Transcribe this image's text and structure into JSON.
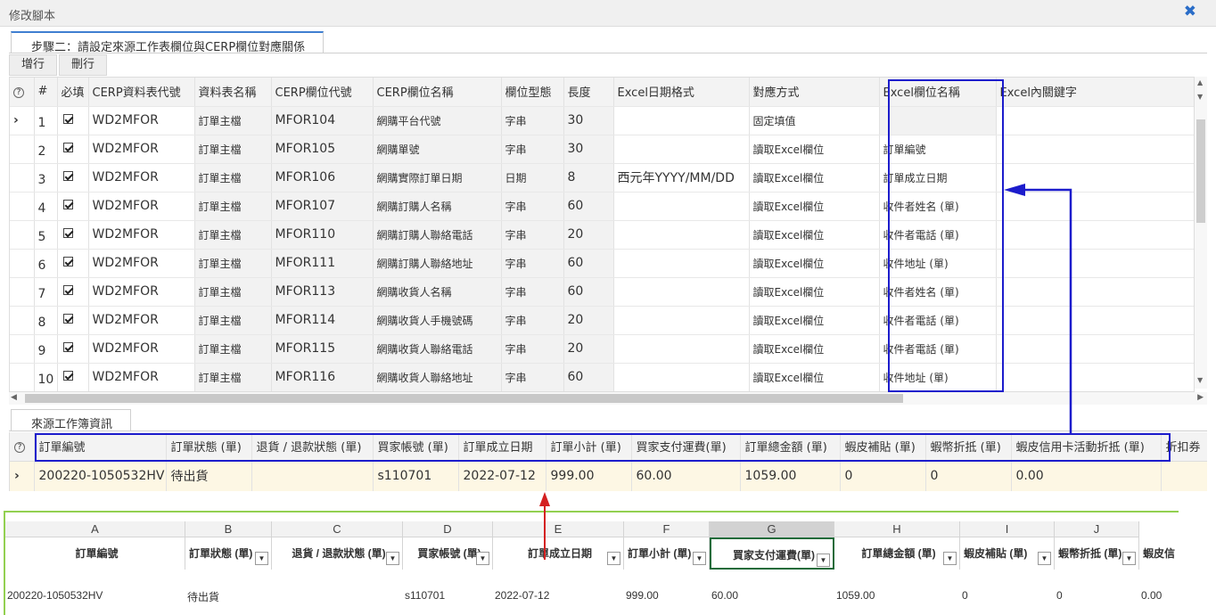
{
  "window": {
    "title": "修改腳本"
  },
  "tabs": {
    "step": "步驟二：請設定來源工作表欄位與CERP欄位對應關係",
    "source": "來源工作簿資訊"
  },
  "toolbar": {
    "add": "增行",
    "delete": "刪行"
  },
  "mapping": {
    "columns": [
      "#",
      "必填",
      "CERP資料表代號",
      "資料表名稱",
      "CERP欄位代號",
      "CERP欄位名稱",
      "欄位型態",
      "長度",
      "Excel日期格式",
      "對應方式",
      "Excel欄位名稱",
      "Excel內關鍵字"
    ],
    "rows": [
      {
        "n": "1",
        "table_code": "WD2MFOR",
        "table_name": "訂單主檔",
        "field_code": "MFOR104",
        "field_name": "網購平台代號",
        "type": "字串",
        "length": "30",
        "date_fmt": "",
        "method": "固定填值",
        "excel_field": ""
      },
      {
        "n": "2",
        "table_code": "WD2MFOR",
        "table_name": "訂單主檔",
        "field_code": "MFOR105",
        "field_name": "網購單號",
        "type": "字串",
        "length": "30",
        "date_fmt": "",
        "method": "讀取Excel欄位",
        "excel_field": "訂單編號"
      },
      {
        "n": "3",
        "table_code": "WD2MFOR",
        "table_name": "訂單主檔",
        "field_code": "MFOR106",
        "field_name": "網購實際訂單日期",
        "type": "日期",
        "length": "8",
        "date_fmt": "西元年YYYY/MM/DD",
        "method": "讀取Excel欄位",
        "excel_field": "訂單成立日期"
      },
      {
        "n": "4",
        "table_code": "WD2MFOR",
        "table_name": "訂單主檔",
        "field_code": "MFOR107",
        "field_name": "網購訂購人名稱",
        "type": "字串",
        "length": "60",
        "date_fmt": "",
        "method": "讀取Excel欄位",
        "excel_field": "收件者姓名 (單)"
      },
      {
        "n": "5",
        "table_code": "WD2MFOR",
        "table_name": "訂單主檔",
        "field_code": "MFOR110",
        "field_name": "網購訂購人聯絡電話",
        "type": "字串",
        "length": "20",
        "date_fmt": "",
        "method": "讀取Excel欄位",
        "excel_field": "收件者電話 (單)"
      },
      {
        "n": "6",
        "table_code": "WD2MFOR",
        "table_name": "訂單主檔",
        "field_code": "MFOR111",
        "field_name": "網購訂購人聯絡地址",
        "type": "字串",
        "length": "60",
        "date_fmt": "",
        "method": "讀取Excel欄位",
        "excel_field": "收件地址 (單)"
      },
      {
        "n": "7",
        "table_code": "WD2MFOR",
        "table_name": "訂單主檔",
        "field_code": "MFOR113",
        "field_name": "網購收貨人名稱",
        "type": "字串",
        "length": "60",
        "date_fmt": "",
        "method": "讀取Excel欄位",
        "excel_field": "收件者姓名 (單)"
      },
      {
        "n": "8",
        "table_code": "WD2MFOR",
        "table_name": "訂單主檔",
        "field_code": "MFOR114",
        "field_name": "網購收貨人手機號碼",
        "type": "字串",
        "length": "20",
        "date_fmt": "",
        "method": "讀取Excel欄位",
        "excel_field": "收件者電話 (單)"
      },
      {
        "n": "9",
        "table_code": "WD2MFOR",
        "table_name": "訂單主檔",
        "field_code": "MFOR115",
        "field_name": "網購收貨人聯絡電話",
        "type": "字串",
        "length": "20",
        "date_fmt": "",
        "method": "讀取Excel欄位",
        "excel_field": "收件者電話 (單)"
      },
      {
        "n": "10",
        "table_code": "WD2MFOR",
        "table_name": "訂單主檔",
        "field_code": "MFOR116",
        "field_name": "網購收貨人聯絡地址",
        "type": "字串",
        "length": "60",
        "date_fmt": "",
        "method": "讀取Excel欄位",
        "excel_field": "收件地址 (單)"
      }
    ]
  },
  "source": {
    "columns": [
      "訂單編號",
      "訂單狀態 (單)",
      "退貨 / 退款狀態 (單)",
      "買家帳號 (單)",
      "訂單成立日期",
      "訂單小計 (單)",
      "買家支付運費(單)",
      "訂單總金額 (單)",
      "蝦皮補貼 (單)",
      "蝦幣折抵 (單)",
      "蝦皮信用卡活動折抵 (單)",
      "折扣券"
    ],
    "row": [
      "200220-1050532HV",
      "待出貨",
      "",
      "s110701",
      "2022-07-12",
      "999.00",
      "60.00",
      "1059.00",
      "0",
      "0",
      "0.00",
      ""
    ]
  },
  "excel": {
    "letters": [
      "A",
      "B",
      "C",
      "D",
      "E",
      "F",
      "G",
      "H",
      "I",
      "J"
    ],
    "headers": [
      "訂單編號",
      "訂單狀態 (單)",
      "退貨 / 退款狀態 (單)",
      "買家帳號 (單)",
      "訂單成立日期",
      "訂單小計 (單)",
      "買家支付運費(單)",
      "訂單總金額 (單)",
      "蝦皮補貼 (單)",
      "蝦幣折抵 (單)",
      "蝦皮信"
    ],
    "row": [
      "200220-1050532HV",
      "待出貨",
      "",
      "s110701",
      "2022-07-12",
      "999.00",
      "60.00",
      "1059.00",
      "0",
      "0",
      "0.00"
    ],
    "selected_column": "G"
  }
}
